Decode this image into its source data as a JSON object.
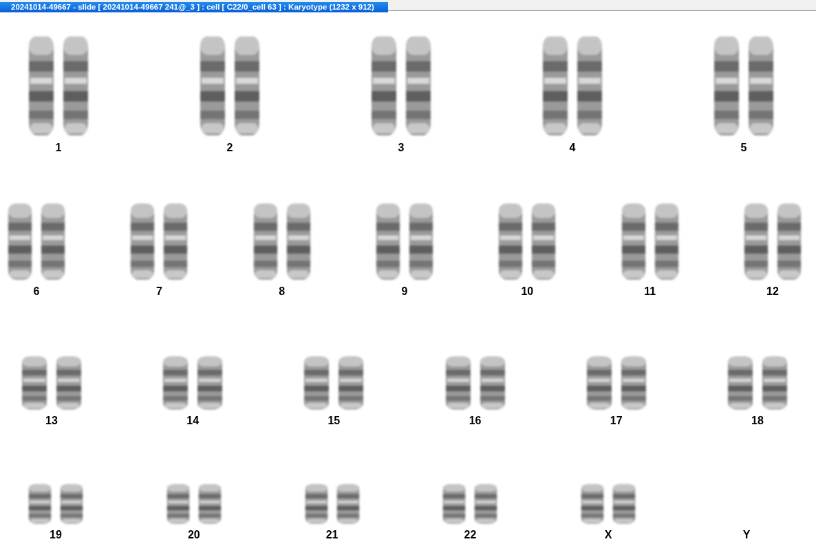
{
  "window": {
    "title": "20241014-49667 - slide [ 20241014-49667 241@_3 ] : cell [ C22/0_cell 63 ] : Karyotype  (1232 x 912)"
  },
  "karyotype_rows": [
    {
      "pairs": [
        {
          "label": "1",
          "chromosomes": [
            {
              "kind": "homolog"
            },
            {
              "kind": "homolog"
            }
          ]
        },
        {
          "label": "2",
          "chromosomes": [
            {
              "kind": "homolog"
            },
            {
              "kind": "homolog"
            }
          ]
        },
        {
          "label": "3",
          "chromosomes": [
            {
              "kind": "homolog"
            },
            {
              "kind": "homolog"
            }
          ]
        },
        {
          "label": "4",
          "chromosomes": [
            {
              "kind": "homolog"
            },
            {
              "kind": "homolog"
            }
          ]
        },
        {
          "label": "5",
          "chromosomes": [
            {
              "kind": "homolog"
            },
            {
              "kind": "homolog"
            }
          ]
        }
      ]
    },
    {
      "pairs": [
        {
          "label": "6",
          "chromosomes": [
            {
              "kind": "homolog"
            },
            {
              "kind": "homolog"
            }
          ]
        },
        {
          "label": "7",
          "chromosomes": [
            {
              "kind": "homolog"
            },
            {
              "kind": "homolog"
            }
          ]
        },
        {
          "label": "8",
          "chromosomes": [
            {
              "kind": "homolog"
            },
            {
              "kind": "homolog"
            }
          ]
        },
        {
          "label": "9",
          "chromosomes": [
            {
              "kind": "homolog"
            },
            {
              "kind": "homolog"
            }
          ]
        },
        {
          "label": "10",
          "chromosomes": [
            {
              "kind": "homolog"
            },
            {
              "kind": "homolog"
            }
          ]
        },
        {
          "label": "11",
          "chromosomes": [
            {
              "kind": "homolog"
            },
            {
              "kind": "homolog"
            }
          ]
        },
        {
          "label": "12",
          "chromosomes": [
            {
              "kind": "homolog"
            },
            {
              "kind": "homolog"
            }
          ]
        }
      ]
    },
    {
      "pairs": [
        {
          "label": "13",
          "chromosomes": [
            {
              "kind": "homolog"
            },
            {
              "kind": "homolog"
            }
          ]
        },
        {
          "label": "14",
          "chromosomes": [
            {
              "kind": "homolog"
            },
            {
              "kind": "homolog"
            }
          ]
        },
        {
          "label": "15",
          "chromosomes": [
            {
              "kind": "homolog"
            },
            {
              "kind": "homolog"
            }
          ]
        },
        {
          "label": "16",
          "chromosomes": [
            {
              "kind": "homolog"
            },
            {
              "kind": "homolog"
            }
          ]
        },
        {
          "label": "17",
          "chromosomes": [
            {
              "kind": "homolog"
            },
            {
              "kind": "homolog"
            }
          ]
        },
        {
          "label": "18",
          "chromosomes": [
            {
              "kind": "homolog"
            },
            {
              "kind": "homolog"
            }
          ]
        }
      ]
    },
    {
      "pairs": [
        {
          "label": "19",
          "chromosomes": [
            {
              "kind": "homolog"
            },
            {
              "kind": "homolog"
            }
          ]
        },
        {
          "label": "20",
          "chromosomes": [
            {
              "kind": "homolog"
            },
            {
              "kind": "homolog"
            }
          ]
        },
        {
          "label": "21",
          "chromosomes": [
            {
              "kind": "homolog"
            },
            {
              "kind": "homolog"
            }
          ]
        },
        {
          "label": "22",
          "chromosomes": [
            {
              "kind": "homolog"
            },
            {
              "kind": "homolog"
            }
          ]
        },
        {
          "label": "X",
          "chromosomes": [
            {
              "kind": "homolog"
            },
            {
              "kind": "homolog"
            }
          ]
        },
        {
          "label": "Y"
        }
      ]
    }
  ]
}
